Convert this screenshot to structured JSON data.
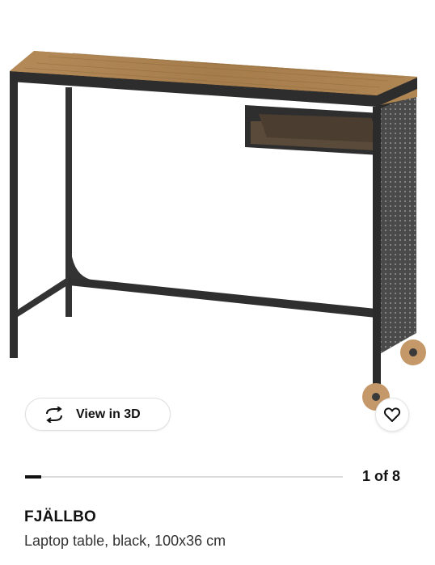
{
  "product": {
    "name": "FJÄLLBO",
    "description": "Laptop table, black, 100x36 cm"
  },
  "gallery": {
    "view3d_label": "View in 3D",
    "current_index": "1",
    "separator": "of",
    "total": "8",
    "progress_fraction": 0.125
  },
  "icons": {
    "view3d": "rotate-3d-icon",
    "favorite": "heart-outline-icon"
  },
  "colors": {
    "accent": "#111111",
    "track": "#dcdcdc",
    "wood": "#a9804f",
    "metal": "#3a3a3a"
  }
}
